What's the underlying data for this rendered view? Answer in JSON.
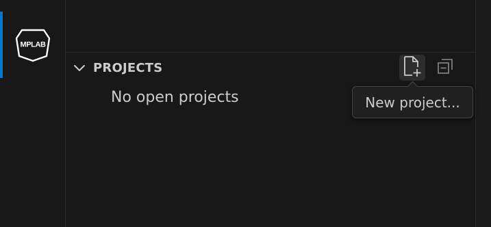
{
  "activity_bar": {
    "items": [
      {
        "icon": "mplab-logo-icon",
        "label": "MPLAB",
        "active": true
      }
    ],
    "accent_color": "#0078d4"
  },
  "projects_section": {
    "title": "PROJECTS",
    "expanded": true,
    "empty_message": "No open projects",
    "actions": [
      {
        "icon": "new-file-icon",
        "hovered": true
      },
      {
        "icon": "collapse-all-icon",
        "hovered": false
      }
    ]
  },
  "tooltip": {
    "text": "New project..."
  }
}
